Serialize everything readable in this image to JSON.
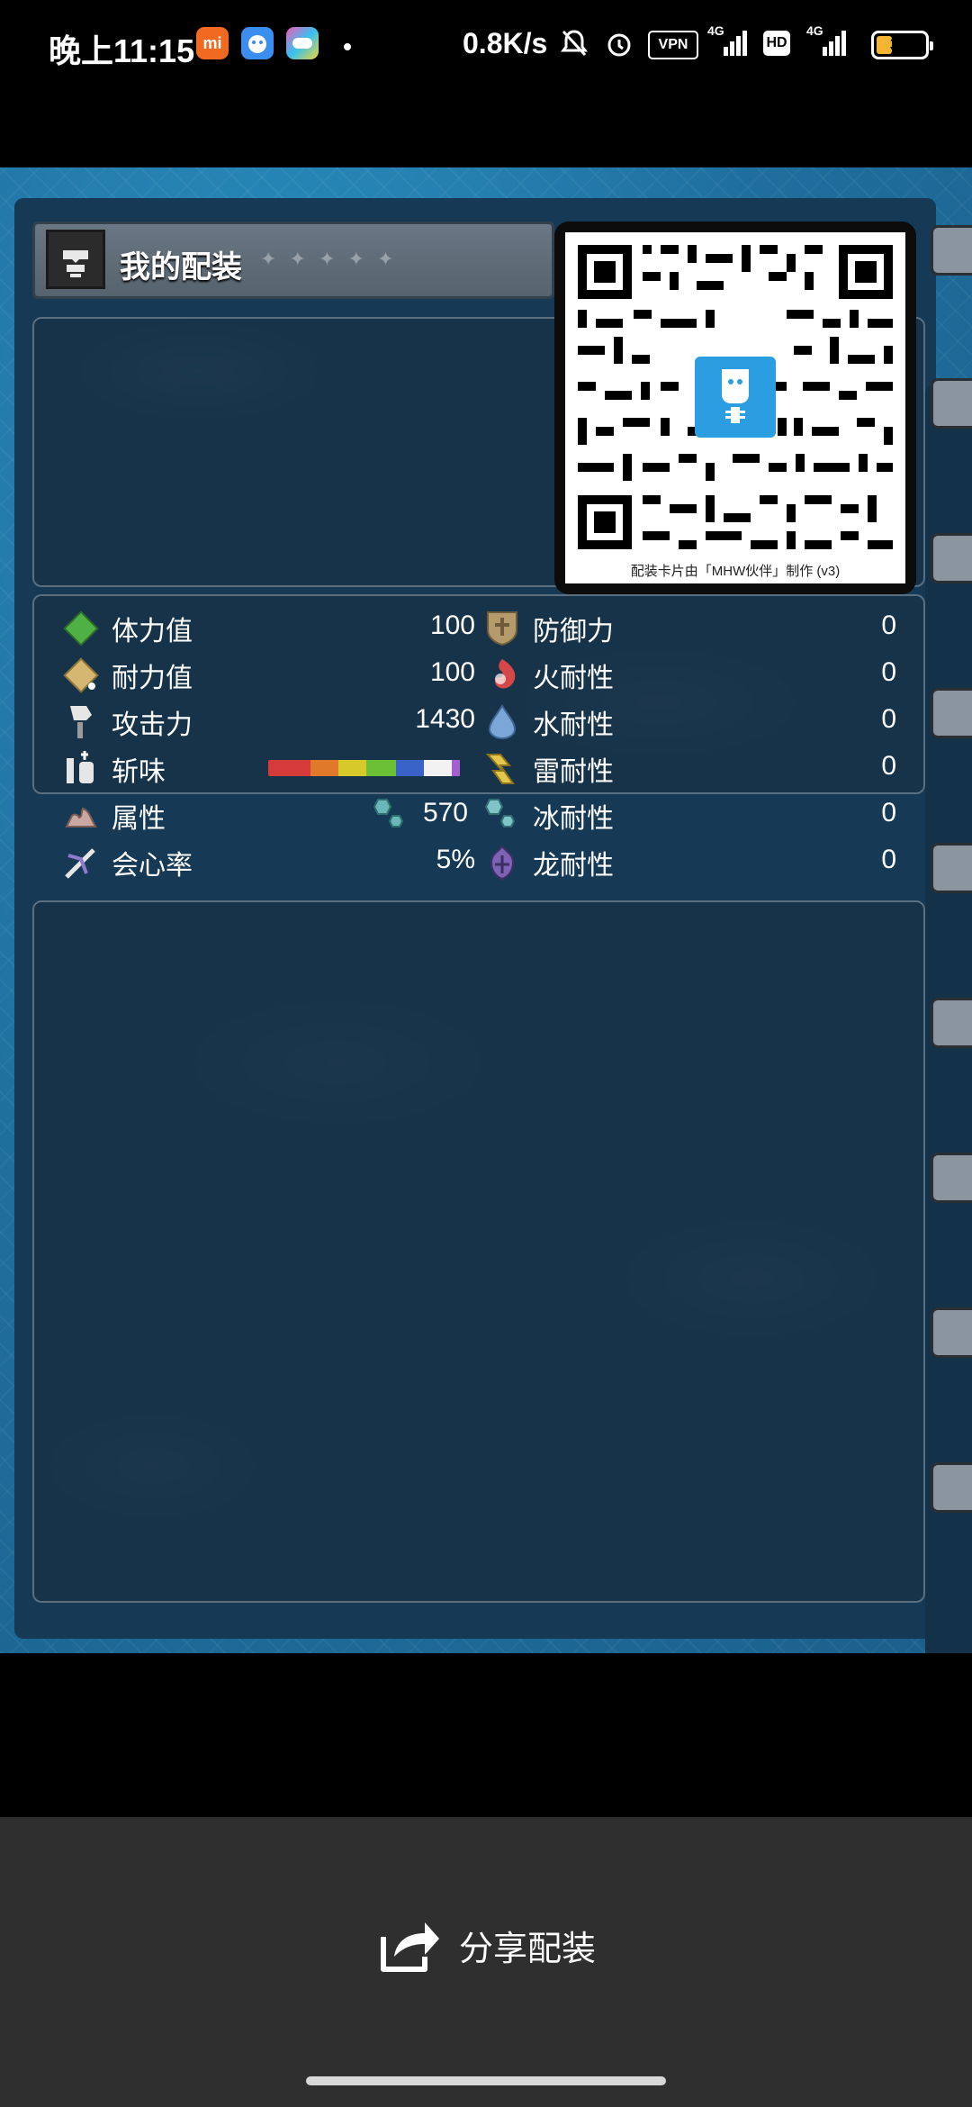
{
  "status_bar": {
    "time": "晚上11:15",
    "network_speed": "0.8K/s",
    "vpn": "VPN",
    "hd": "HD",
    "signal1": "4G",
    "signal2": "4G",
    "battery": "31"
  },
  "card": {
    "title": "我的配装",
    "qr_caption": "配装卡片由「MHW伙伴」制作 (v3)",
    "stats_left": [
      {
        "label": "体力值",
        "value": "100",
        "icon": "health-icon"
      },
      {
        "label": "耐力值",
        "value": "100",
        "icon": "stamina-icon"
      },
      {
        "label": "攻击力",
        "value": "1430",
        "icon": "attack-icon"
      },
      {
        "label": "斩味",
        "value": "",
        "icon": "sharpness-icon"
      },
      {
        "label": "属性",
        "value": "570",
        "icon": "element-icon"
      },
      {
        "label": "会心率",
        "value": "5%",
        "icon": "affinity-icon"
      }
    ],
    "stats_right": [
      {
        "label": "防御力",
        "value": "0",
        "icon": "defense-icon"
      },
      {
        "label": "火耐性",
        "value": "0",
        "icon": "fire-res-icon"
      },
      {
        "label": "水耐性",
        "value": "0",
        "icon": "water-res-icon"
      },
      {
        "label": "雷耐性",
        "value": "0",
        "icon": "thunder-res-icon"
      },
      {
        "label": "冰耐性",
        "value": "0",
        "icon": "ice-res-icon"
      },
      {
        "label": "龙耐性",
        "value": "0",
        "icon": "dragon-res-icon"
      }
    ],
    "sharpness_colors": [
      "#d63a3a",
      "#e07a2a",
      "#d8c92a",
      "#6cc036",
      "#3a63c9",
      "#f2f2f2",
      "#a55fd0"
    ],
    "sharpness_fractions": [
      0.21,
      0.14,
      0.14,
      0.15,
      0.14,
      0.14,
      0.04
    ]
  },
  "bottom": {
    "share_label": "分享配装"
  }
}
